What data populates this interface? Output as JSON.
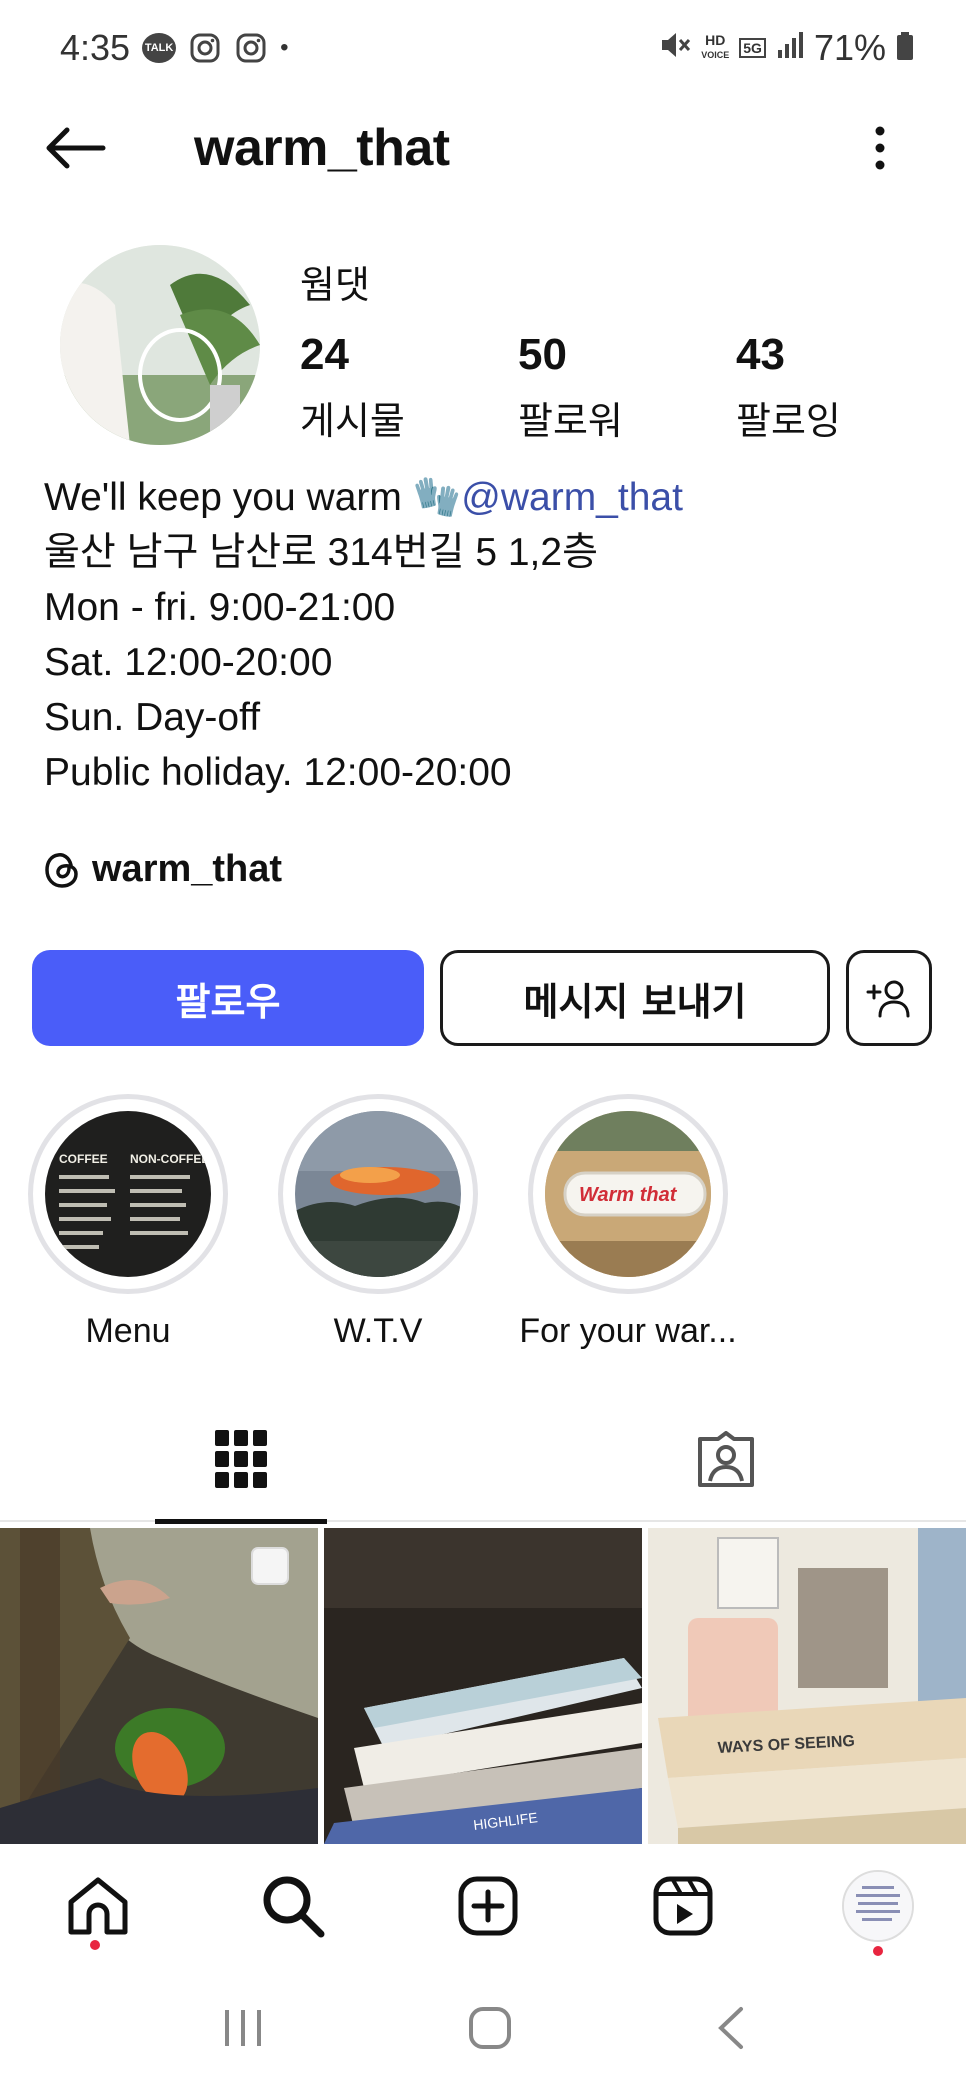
{
  "status_bar": {
    "time": "4:35",
    "talk_badge": "TALK",
    "battery": "71%",
    "hd_label": "HD",
    "voice_label": "VOICE",
    "network": "5G"
  },
  "header": {
    "username": "warm_that"
  },
  "profile": {
    "display_name": "웜댓",
    "stats": [
      {
        "num": "24",
        "label": "게시물"
      },
      {
        "num": "50",
        "label": "팔로워"
      },
      {
        "num": "43",
        "label": "팔로잉"
      }
    ],
    "bio": {
      "line1_text": "We'll keep you warm 🧤",
      "line1_mention": "@warm_that",
      "line2": "울산 남구 남산로 314번길 5 1,2층",
      "line3": "Mon - fri.  9:00-21:00",
      "line4": "Sat.  12:00-20:00",
      "line5": "Sun.  Day-off",
      "line6": "Public holiday. 12:00-20:00"
    },
    "threads_handle": "warm_that"
  },
  "actions": {
    "follow": "팔로우",
    "message": "메시지 보내기"
  },
  "highlights": [
    {
      "label": "Menu",
      "icon": "coffee-menu-board"
    },
    {
      "label": "W.T.V",
      "icon": "sunset-photo"
    },
    {
      "label": "For your war...",
      "icon": "warm-that-sign"
    }
  ],
  "highlight_art": {
    "coffee": "COFFEE",
    "non_coffee": "NON-COFFEE",
    "sign": "Warm that"
  },
  "tabs": [
    {
      "icon": "grid-icon"
    },
    {
      "icon": "tagged-icon"
    }
  ],
  "posts": [
    {
      "icon": "carrot-keychain-photo"
    },
    {
      "icon": "books-stack-photo"
    },
    {
      "icon": "ways-of-seeing-photo"
    }
  ],
  "post_art": {
    "book1": "WAYS OF SEEING",
    "book2": "HIGHLIFE"
  },
  "colors": {
    "accent": "#4a5df9",
    "mention": "#3b4fa8",
    "notification": "#e8253f"
  }
}
